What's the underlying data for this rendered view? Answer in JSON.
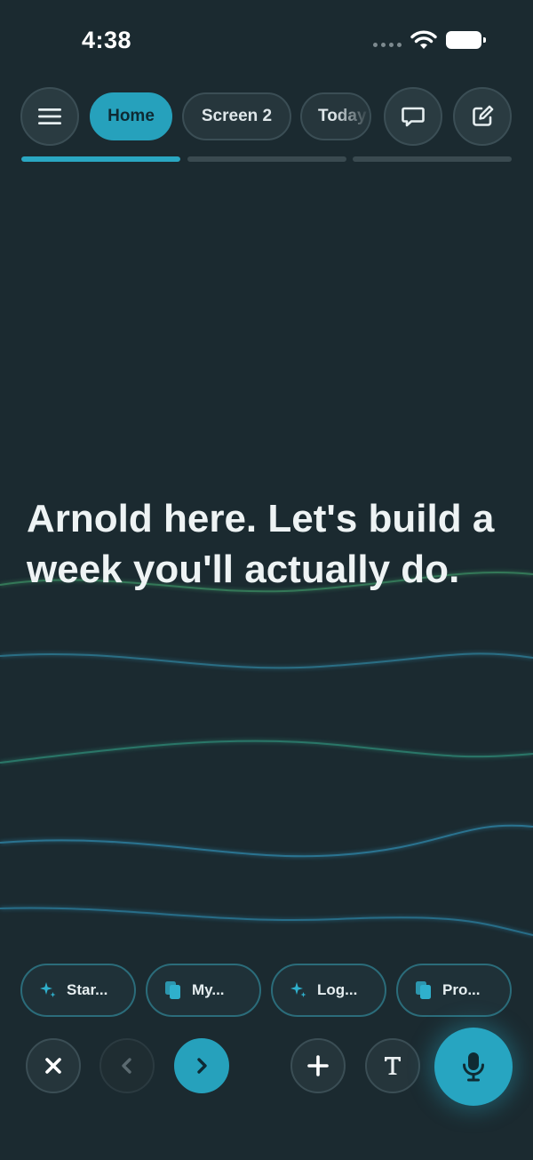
{
  "status": {
    "time": "4:38"
  },
  "nav": {
    "tabs": [
      {
        "label": "Home",
        "active": true
      },
      {
        "label": "Screen 2",
        "active": false
      },
      {
        "label": "Today",
        "active": false
      }
    ],
    "progress": [
      1.0,
      0.0,
      0.0
    ]
  },
  "main": {
    "headline": "Arnold here. Let's build a week you'll actually do."
  },
  "chips": [
    {
      "label": "Star...",
      "icon": "sparkle-icon"
    },
    {
      "label": "My...",
      "icon": "copy-icon"
    },
    {
      "label": "Log...",
      "icon": "sparkle-icon"
    },
    {
      "label": "Pro...",
      "icon": "copy-icon"
    }
  ],
  "colors": {
    "background": "#1b2a30",
    "accent": "#26a1bc",
    "wave_blue": "#2f8fb0",
    "wave_green": "#2f9a7a"
  }
}
